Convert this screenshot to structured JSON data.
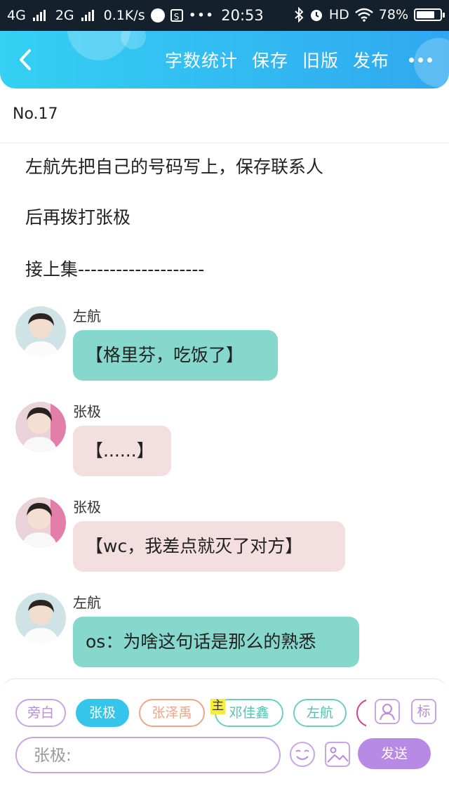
{
  "status_bar": {
    "network1": "4G",
    "network2": "2G",
    "speed": "0.1K/s",
    "time": "20:53",
    "hd": "HD",
    "battery_percent": "78%",
    "battery_level": 0.78,
    "icons": [
      "signal-icon",
      "app-notification-icon",
      "s-app-icon",
      "more-dots-icon",
      "bluetooth-icon",
      "alarm-icon",
      "wifi-icon",
      "battery-icon"
    ]
  },
  "header": {
    "back_icon": "chevron-left-icon",
    "actions": [
      "字数统计",
      "保存",
      "旧版",
      "发布"
    ],
    "more_icon": "more-dots-icon",
    "gradient": [
      "#35d0f3",
      "#2fa8f0"
    ]
  },
  "chapter": {
    "number": "No.17"
  },
  "narration": [
    "左航先把自己的号码写上，保存联系人",
    "后再拨打张极",
    "接上集--------------------"
  ],
  "messages": [
    {
      "speaker": "左航",
      "text": "【格里芬，吃饭了】",
      "color": "#86d8cc"
    },
    {
      "speaker": "张极",
      "text": "【......】",
      "color": "#f3dfdf"
    },
    {
      "speaker": "张极",
      "text": "【wc，我差点就灭了对方】",
      "color": "#f3dfdf"
    },
    {
      "speaker": "左航",
      "text": "os：为啥这句话是那么的熟悉",
      "color": "#86d8cc"
    }
  ],
  "composer": {
    "chips": [
      {
        "label": "旁白",
        "color": "#c8a6e6",
        "text_color": "#b98bdf",
        "selected": false
      },
      {
        "label": "张极",
        "color": "#35c4ea",
        "text_color": "#ffffff",
        "selected": true
      },
      {
        "label": "张泽禹",
        "color": "#f2a48a",
        "text_color": "#f2a48a",
        "selected": false
      },
      {
        "label": "邓佳鑫",
        "color": "#6ecfc0",
        "text_color": "#55c2b0",
        "selected": false,
        "badge": "主"
      },
      {
        "label": "左航",
        "color": "#6ecfc0",
        "text_color": "#55c2b0",
        "selected": false
      }
    ],
    "tool_icons": [
      "character-manage-icon",
      "tag-icon"
    ],
    "tag_label": "标",
    "input_placeholder": "张极:",
    "emoji_icon": "emoji-icon",
    "image_icon": "image-icon",
    "send_label": "发送",
    "accent": "#b78ae6"
  }
}
